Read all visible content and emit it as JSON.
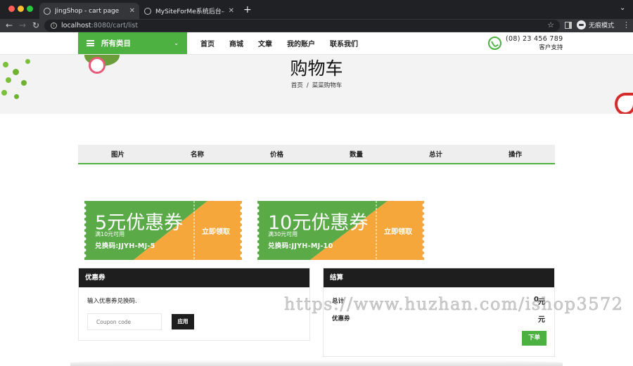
{
  "browser": {
    "tabs": [
      {
        "title": "JingShop - cart page",
        "close": "✕"
      },
      {
        "title": "MySiteForMe系统后台---孤独的",
        "close": "✕"
      }
    ],
    "new_tab": "+",
    "url_host": "localhost",
    "url_path": ":8080/cart/list",
    "incognito_label": "无痕模式"
  },
  "header": {
    "category_label": "所有类目",
    "nav": [
      "首页",
      "商城",
      "文章",
      "我的账户",
      "联系我们"
    ],
    "phone": "(08) 23 456 789",
    "support_label": "客户支持"
  },
  "page": {
    "title": "购物车",
    "breadcrumb": [
      "首页",
      "/",
      "菜菜购物车"
    ]
  },
  "cart_table": {
    "columns": [
      "图片",
      "名称",
      "价格",
      "数量",
      "总计",
      "操作"
    ]
  },
  "coupons": [
    {
      "amount": "5元优惠券",
      "condition": "满10元可用",
      "code": "兑换码:JJYH-MJ-5",
      "claim": "立即领取"
    },
    {
      "amount": "10元优惠券",
      "condition": "满30元可用",
      "code": "兑换码:JJYH-MJ-10",
      "claim": "立即领取"
    }
  ],
  "coupon_panel": {
    "title": "优惠券",
    "intro": "输入优惠券兑换码.",
    "placeholder": "Coupon code",
    "apply": "应用"
  },
  "summary_panel": {
    "title": "结算",
    "total_label": "总计",
    "total_value": "0",
    "total_unit": "元",
    "coupon_label": "优惠券",
    "coupon_unit": "元",
    "checkout": "下单"
  },
  "watermark": "https://www.huzhan.com/ishop3572",
  "colors": {
    "brand_green": "#4cb141",
    "coupon_orange": "#f5a73c",
    "dark": "#1e1e1e"
  }
}
